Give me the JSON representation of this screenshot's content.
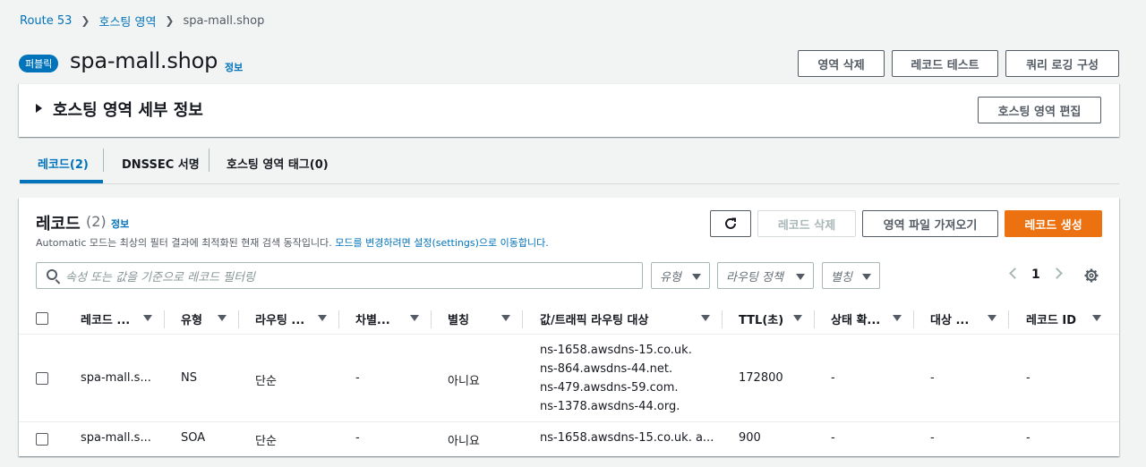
{
  "breadcrumb": {
    "root": "Route 53",
    "section": "호스팅 영역",
    "current": "spa-mall.shop"
  },
  "header": {
    "badge": "퍼블릭",
    "title": "spa-mall.shop",
    "info": "정보",
    "buttons": {
      "delete_zone": "영역 삭제",
      "test_record": "레코드 테스트",
      "query_logging": "쿼리 로깅 구성"
    }
  },
  "details": {
    "title": "호스팅 영역 세부 정보",
    "edit_button": "호스팅 영역 편집"
  },
  "tabs": [
    {
      "label": "레코드(2)",
      "active": true
    },
    {
      "label": "DNSSEC 서명",
      "active": false
    },
    {
      "label": "호스팅 영역 태그(0)",
      "active": false
    }
  ],
  "records": {
    "title": "레코드",
    "count": "(2)",
    "info": "정보",
    "description": "Automatic 모드는 최상의 필터 결과에 최적화된 현재 검색 동작입니다. ",
    "description_link": "모드를 변경하려면 설정(settings)으로 이동합니다.",
    "buttons": {
      "delete": "레코드 삭제",
      "import": "영역 파일 가져오기",
      "create": "레코드 생성"
    },
    "search_placeholder": "속성 또는 값을 기준으로 레코드 필터링",
    "filters": {
      "type": "유형",
      "routing": "라우팅 정책",
      "alias": "별칭"
    },
    "page": "1",
    "columns": [
      "레코드 ...",
      "유형",
      "라우팅 ...",
      "차별...",
      "별칭",
      "값/트래픽 라우팅 대상",
      "TTL(초)",
      "상태 확...",
      "대상 ...",
      "레코드 ID"
    ],
    "rows": [
      {
        "name": "spa-mall.s...",
        "type": "NS",
        "routing": "단순",
        "differentiator": "-",
        "alias": "아니요",
        "values": [
          "ns-1658.awsdns-15.co.uk.",
          "ns-864.awsdns-44.net.",
          "ns-479.awsdns-59.com.",
          "ns-1378.awsdns-44.org."
        ],
        "ttl": "172800",
        "health": "-",
        "target": "-",
        "record_id": "-"
      },
      {
        "name": "spa-mall.s...",
        "type": "SOA",
        "routing": "단순",
        "differentiator": "-",
        "alias": "아니요",
        "values": [
          "ns-1658.awsdns-15.co.uk. a..."
        ],
        "ttl": "900",
        "health": "-",
        "target": "-",
        "record_id": "-"
      }
    ]
  },
  "colors": {
    "link": "#0073bb",
    "primary": "#ec7211",
    "background": "#f2f3f3"
  }
}
